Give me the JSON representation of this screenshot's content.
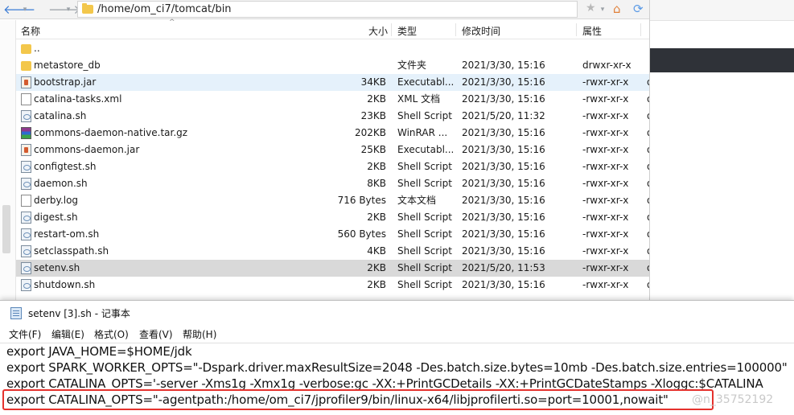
{
  "file_manager": {
    "path": "/home/om_ci7/tomcat/bin",
    "columns": {
      "name": "名称",
      "size": "大小",
      "type": "类型",
      "modified": "修改时间",
      "attributes": "属性"
    },
    "rows": [
      {
        "icon": "folder-icon",
        "name": "..",
        "size": "",
        "type": "",
        "modified": "",
        "perm": "",
        "owner": ""
      },
      {
        "icon": "folder-icon",
        "name": "metastore_db",
        "size": "",
        "type": "文件夹",
        "modified": "2021/3/30, 15:16",
        "perm": "drwxr-xr-x",
        "owner": ""
      },
      {
        "icon": "jar-file-icon",
        "name": "bootstrap.jar",
        "size": "34KB",
        "type": "Executabl...",
        "modified": "2021/3/30, 15:16",
        "perm": "-rwxr-xr-x",
        "owner": "o"
      },
      {
        "icon": "file-icon",
        "name": "catalina-tasks.xml",
        "size": "2KB",
        "type": "XML 文档",
        "modified": "2021/3/30, 15:16",
        "perm": "-rwxr-xr-x",
        "owner": "o"
      },
      {
        "icon": "script-file-icon",
        "name": "catalina.sh",
        "size": "23KB",
        "type": "Shell Script",
        "modified": "2021/5/20, 11:32",
        "perm": "-rwxr-xr-x",
        "owner": "o"
      },
      {
        "icon": "archive-icon",
        "name": "commons-daemon-native.tar.gz",
        "size": "202KB",
        "type": "WinRAR ...",
        "modified": "2021/3/30, 15:16",
        "perm": "-rwxr-xr-x",
        "owner": "o"
      },
      {
        "icon": "jar-file-icon",
        "name": "commons-daemon.jar",
        "size": "25KB",
        "type": "Executabl...",
        "modified": "2021/3/30, 15:16",
        "perm": "-rwxr-xr-x",
        "owner": "o"
      },
      {
        "icon": "script-file-icon",
        "name": "configtest.sh",
        "size": "2KB",
        "type": "Shell Script",
        "modified": "2021/3/30, 15:16",
        "perm": "-rwxr-xr-x",
        "owner": "o"
      },
      {
        "icon": "script-file-icon",
        "name": "daemon.sh",
        "size": "8KB",
        "type": "Shell Script",
        "modified": "2021/3/30, 15:16",
        "perm": "-rwxr-xr-x",
        "owner": "o"
      },
      {
        "icon": "file-icon",
        "name": "derby.log",
        "size": "716 Bytes",
        "type": "文本文档",
        "modified": "2021/3/30, 15:16",
        "perm": "-rwxr-xr-x",
        "owner": "o"
      },
      {
        "icon": "script-file-icon",
        "name": "digest.sh",
        "size": "2KB",
        "type": "Shell Script",
        "modified": "2021/3/30, 15:16",
        "perm": "-rwxr-xr-x",
        "owner": "o"
      },
      {
        "icon": "script-file-icon",
        "name": "restart-om.sh",
        "size": "560 Bytes",
        "type": "Shell Script",
        "modified": "2021/3/30, 15:16",
        "perm": "-rwxr-xr-x",
        "owner": "o"
      },
      {
        "icon": "script-file-icon",
        "name": "setclasspath.sh",
        "size": "4KB",
        "type": "Shell Script",
        "modified": "2021/3/30, 15:16",
        "perm": "-rwxr-xr-x",
        "owner": "o"
      },
      {
        "icon": "script-file-icon",
        "name": "setenv.sh",
        "size": "2KB",
        "type": "Shell Script",
        "modified": "2021/5/20, 11:53",
        "perm": "-rwxr-xr-x",
        "owner": "o"
      },
      {
        "icon": "script-file-icon",
        "name": "shutdown.sh",
        "size": "2KB",
        "type": "Shell Script",
        "modified": "2021/3/30, 15:16",
        "perm": "-rwxr-xr-x",
        "owner": "o"
      }
    ],
    "selected_rows": [
      "bootstrap.jar",
      "setenv.sh"
    ]
  },
  "notepad": {
    "title": "setenv [3].sh - 记事本",
    "menu": [
      "文件(F)",
      "编辑(E)",
      "格式(O)",
      "查看(V)",
      "帮助(H)"
    ],
    "lines": [
      "export JAVA_HOME=$HOME/jdk",
      "export SPARK_WORKER_OPTS=\"-Dspark.driver.maxResultSize=2048 -Des.batch.size.bytes=10mb -Des.batch.size.entries=100000\"",
      "export CATALINA_OPTS='-server -Xms1g -Xmx1g -verbose:gc -XX:+PrintGCDetails -XX:+PrintGCDateStamps -Xloggc:$CATALINA",
      "export CATALINA_OPTS=\"-agentpath:/home/om_ci7/jprofiler9/bin/linux-x64/libjprofilerti.so=port=10001,nowait\""
    ],
    "highlight_color": "#e5322d",
    "watermark": "@n_35752192"
  }
}
